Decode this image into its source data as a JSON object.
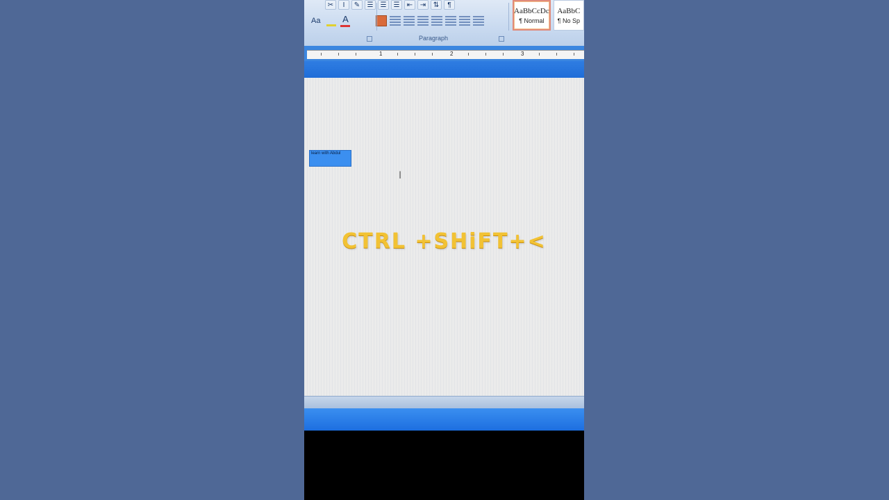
{
  "ribbon": {
    "font_size_label": "Aa",
    "paragraph_group_label": "Paragraph",
    "styles": [
      {
        "sample": "AaBbCcDc",
        "name": "¶ Normal",
        "active": true
      },
      {
        "sample": "AaBbC",
        "name": "¶ No Sp",
        "active": false
      }
    ]
  },
  "ruler": {
    "numbers": [
      "1",
      "2",
      "3"
    ]
  },
  "document": {
    "selected_text": "learn with Abdul",
    "cursor_glyph": "I"
  },
  "overlay": {
    "shortcut_text": "CTRL +SHiFT+<",
    "color": "#f2c234"
  },
  "colors": {
    "background": "#4f6896",
    "title_blue": "#2f7de2",
    "selection": "#3b8ff0"
  }
}
